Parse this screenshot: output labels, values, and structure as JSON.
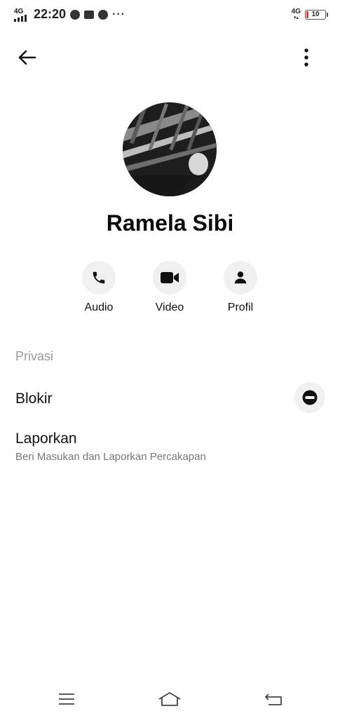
{
  "status_bar": {
    "network_left": "4G",
    "time": "22:20",
    "network_right": "4G",
    "battery": "10"
  },
  "profile": {
    "name": "Ramela Sibi"
  },
  "actions": [
    {
      "label": "Audio",
      "icon": "phone-icon"
    },
    {
      "label": "Video",
      "icon": "video-camera-icon"
    },
    {
      "label": "Profil",
      "icon": "person-icon"
    }
  ],
  "privacy": {
    "section_title": "Privasi",
    "block_label": "Blokir",
    "report_label": "Laporkan",
    "report_sub": "Beri Masukan dan Laporkan Percakapan"
  },
  "colors": {
    "button_bg": "#f0f0f0",
    "text": "#111111",
    "muted": "#9a9a9a"
  }
}
